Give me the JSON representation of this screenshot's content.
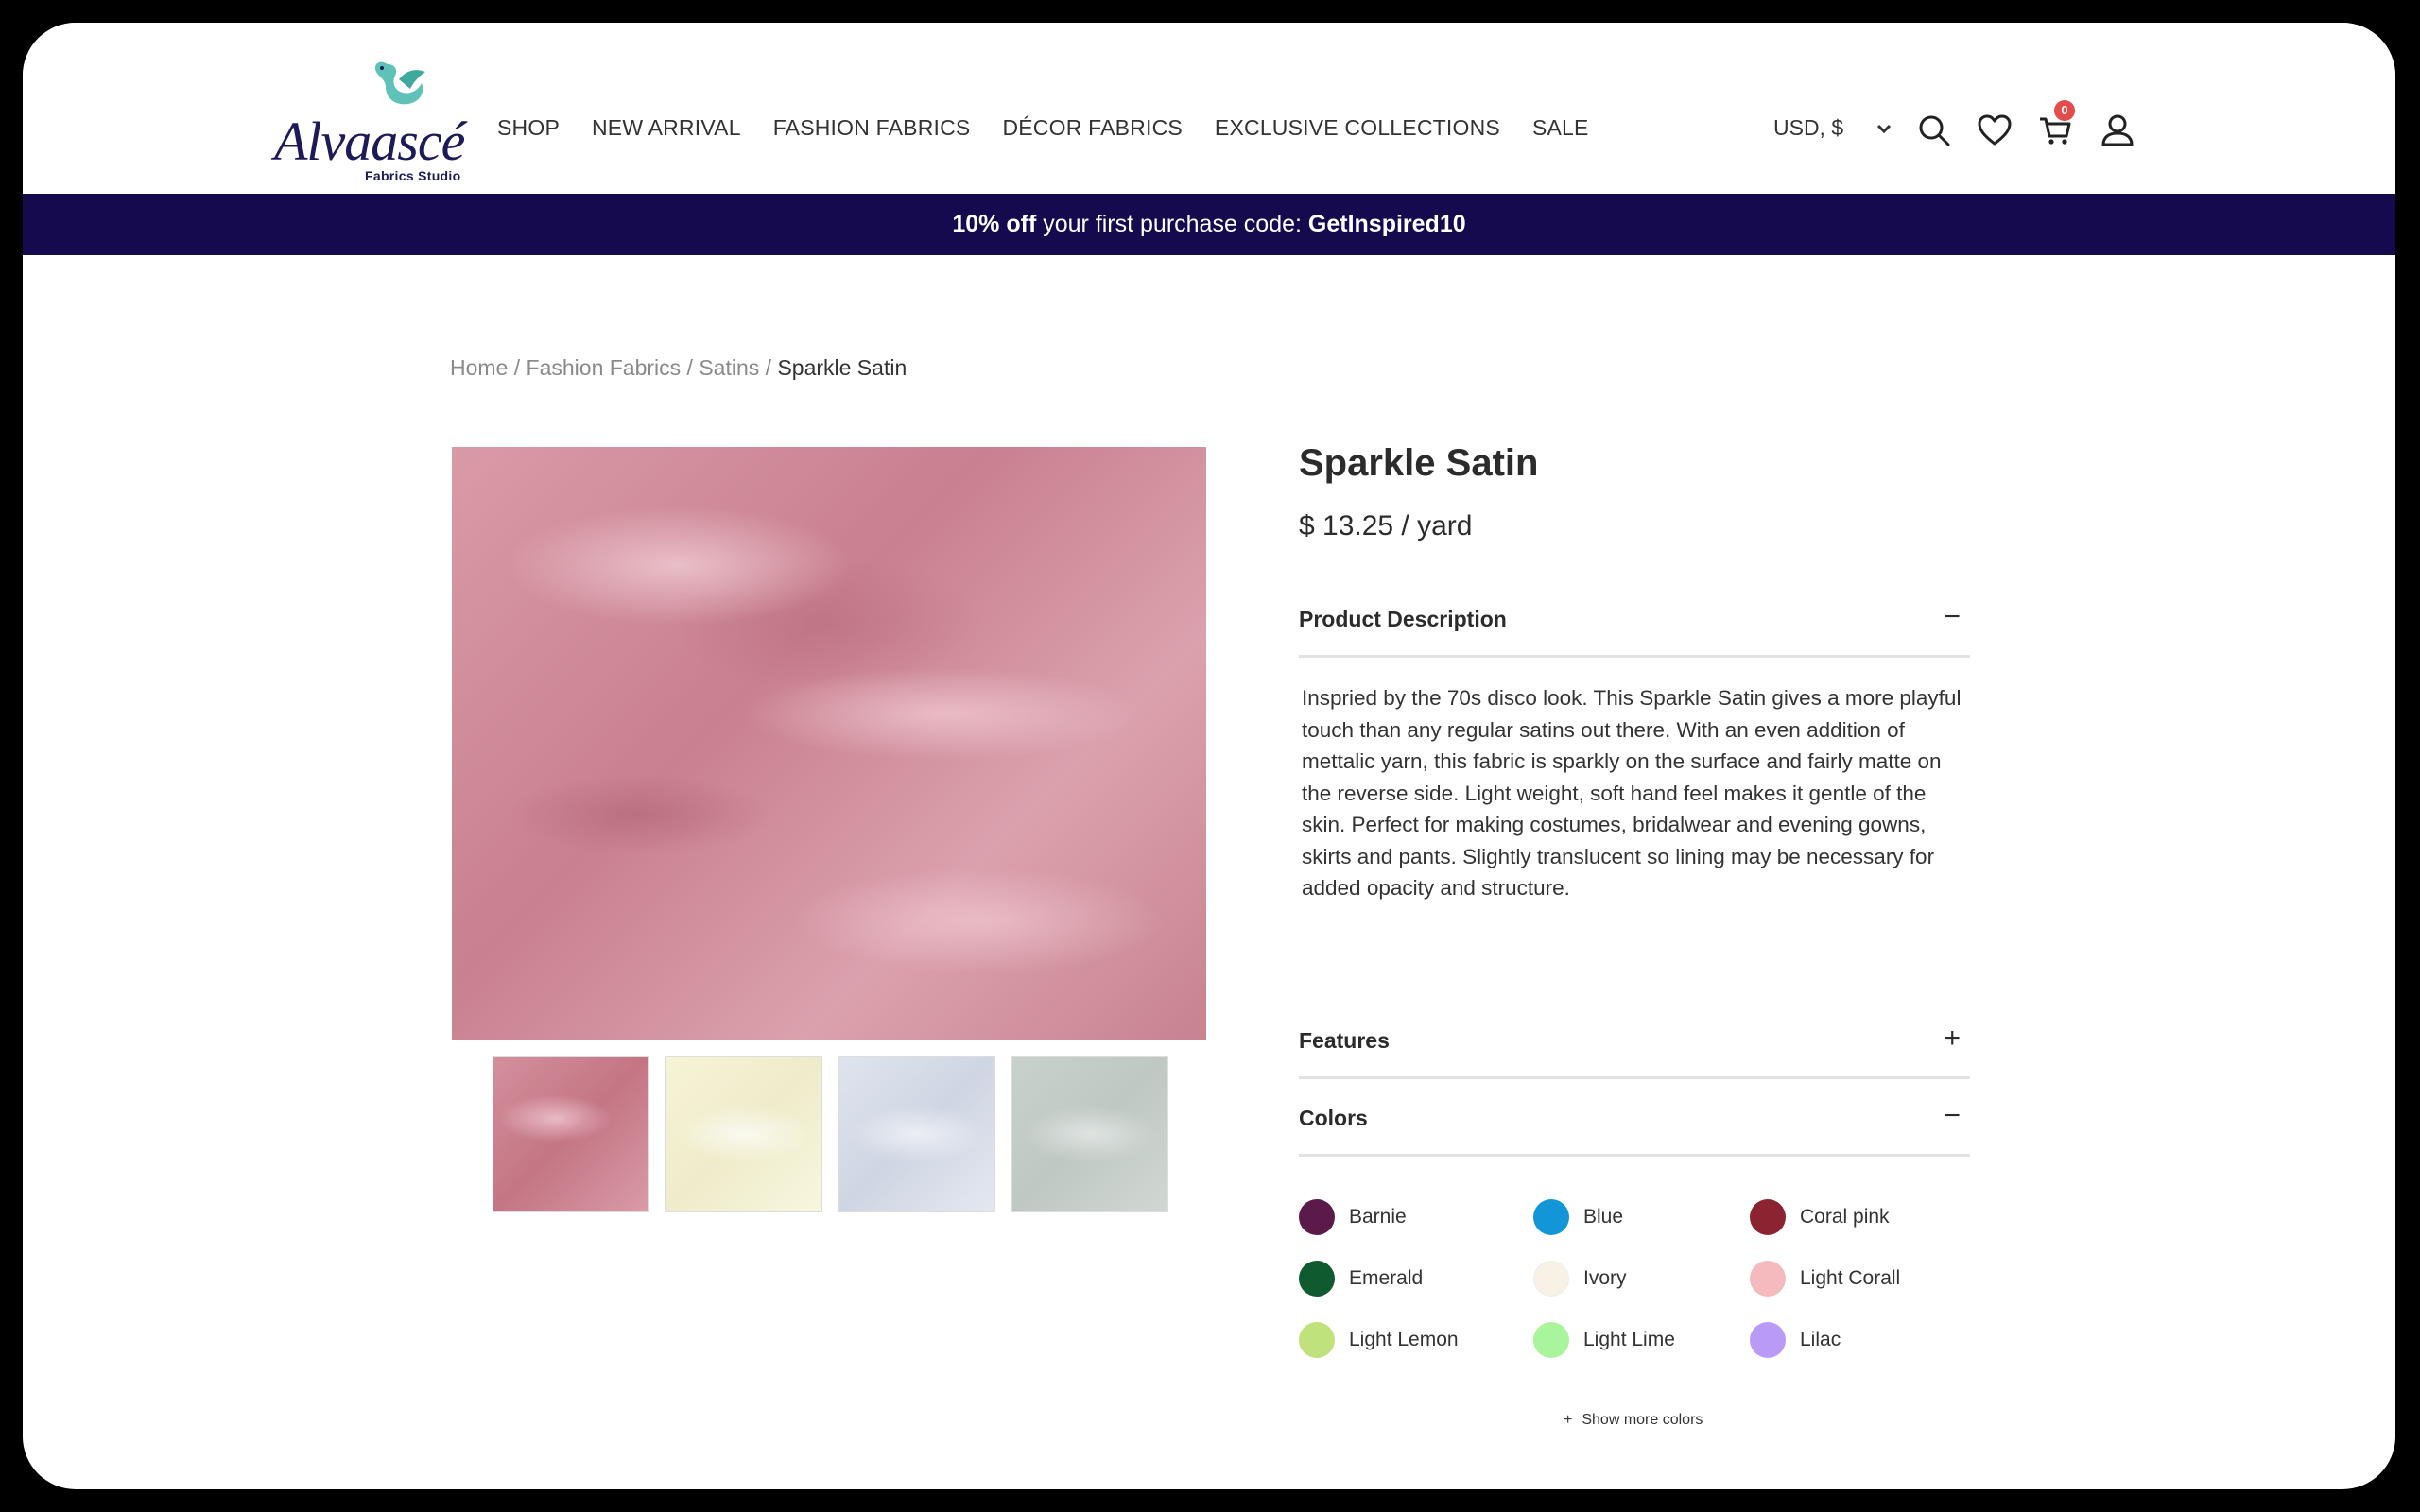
{
  "brand": {
    "name": "Alvaascé",
    "tagline": "Fabrics Studio",
    "accent": "#5ec2b8",
    "navy": "#1d1b57"
  },
  "nav": [
    "SHOP",
    "NEW ARRIVAL",
    "FASHION FABRICS",
    "DÉCOR FABRICS",
    "EXCLUSIVE COLLECTIONS",
    "SALE"
  ],
  "header": {
    "currency": "USD, $",
    "cart_count": "0",
    "icons": [
      "search-icon",
      "heart-icon",
      "cart-icon",
      "user-icon"
    ]
  },
  "promo": {
    "bold1": "10% off",
    "text": " your first purchase code: ",
    "code": "GetInspired10",
    "bg": "#140a4d"
  },
  "breadcrumb": {
    "home": "Home",
    "sep": " / ",
    "cat": "Fashion Fabrics",
    "sub": "Satins",
    "current": "Sparkle Satin"
  },
  "product": {
    "title": "Sparkle Satin",
    "price": "$ 13.25 / yard",
    "description_label": "Product Description",
    "description": "Inspried by the 70s disco look. This Sparkle Satin gives a more playful touch than any regular satins out there. With an even addition of mettalic yarn, this fabric is sparkly on the surface and fairly matte on the reverse side. Light weight, soft hand feel makes it gentle of the skin. Perfect for making costumes, bridalwear and evening gowns, skirts and pants. Slightly translucent so lining may be necessary for added opacity and structure.",
    "features_label": "Features",
    "colors_label": "Colors",
    "toggle_open": "−",
    "toggle_closed": "+",
    "show_more_icon": "+",
    "show_more": "Show more colors"
  },
  "colors": [
    {
      "name": "Barnie",
      "hex": "#5c1a4a"
    },
    {
      "name": "Blue",
      "hex": "#1296d8"
    },
    {
      "name": "Coral pink",
      "hex": "#8b2430"
    },
    {
      "name": "Emerald",
      "hex": "#0f5a2e"
    },
    {
      "name": "Ivory",
      "hex": "#f7f1e6"
    },
    {
      "name": "Light Corall",
      "hex": "#f5babd"
    },
    {
      "name": "Light Lemon",
      "hex": "#bfe27c"
    },
    {
      "name": "Light Lime",
      "hex": "#a9f59c"
    },
    {
      "name": "Lilac",
      "hex": "#b99af5"
    }
  ]
}
